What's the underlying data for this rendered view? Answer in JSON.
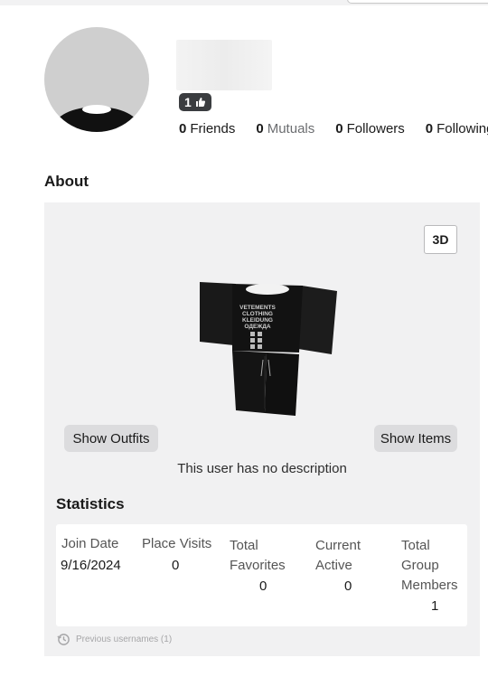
{
  "profile": {
    "badge_count": "1",
    "counts": [
      {
        "num": "0",
        "label": "Friends"
      },
      {
        "num": "0",
        "label": "Mutuals"
      },
      {
        "num": "0",
        "label": "Followers"
      },
      {
        "num": "0",
        "label": "Following"
      }
    ]
  },
  "about": {
    "heading": "About",
    "btn_3d": "3D",
    "show_outfits": "Show Outfits",
    "show_items": "Show Items",
    "description": "This user has no description"
  },
  "shirt_print": {
    "lines": [
      "VETEMENTS",
      "CLOTHING",
      "KLEIDUNG",
      "ОДЕЖДА"
    ]
  },
  "statistics": {
    "heading": "Statistics",
    "join_date": {
      "label": "Join Date",
      "value": "9/16/2024"
    },
    "place_visits": {
      "label": "Place Visits",
      "value": "0"
    },
    "total_favorites": {
      "label_1": "Total",
      "label_2": "Favorites",
      "value": "0"
    },
    "current_active": {
      "label_1": "Current",
      "label_2": "Active",
      "value": "0"
    },
    "group_members": {
      "label_1": "Total",
      "label_2": "Group",
      "label_3": "Members",
      "value": "1"
    }
  },
  "previous_usernames": "Previous usernames (1)",
  "colors": {
    "badge_bg": "#3b3d40",
    "panel_bg": "#f1f1f2",
    "pill_bg": "#dcdcde"
  }
}
